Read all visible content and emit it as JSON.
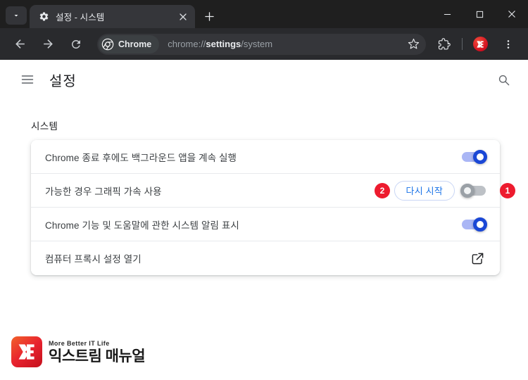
{
  "browser": {
    "window_title": "설정 - 시스템",
    "tab": {
      "title": "설정 - 시스템",
      "favicon": "gear-icon",
      "close_label": "×"
    },
    "tab_search_label": "chevron-down-icon",
    "new_tab_label": "+",
    "window_controls": {
      "minimize": "minimize-icon",
      "maximize": "maximize-icon",
      "close": "close-icon"
    },
    "toolbar": {
      "back": "back-arrow-icon",
      "forward": "forward-arrow-icon",
      "reload": "reload-icon",
      "site_chip_label": "Chrome",
      "url_prefix": "chrome://",
      "url_bold": "settings",
      "url_suffix": "/system",
      "url_full": "chrome://settings/system",
      "bookmark": "star-icon",
      "extensions": "puzzle-piece-icon",
      "profile": "profile-avatar",
      "menu": "three-dot-menu-icon"
    }
  },
  "settings": {
    "menu_label": "hamburger-menu-icon",
    "page_title": "설정",
    "search_label": "search-icon",
    "section_label": "시스템",
    "rows": [
      {
        "label": "Chrome 종료 후에도 백그라운드 앱을 계속 실행",
        "control": "toggle",
        "state": "on"
      },
      {
        "label": "가능한 경우 그래픽 가속 사용",
        "control": "toggle",
        "state": "off",
        "restart_button": "다시 시작"
      },
      {
        "label": "Chrome 기능 및 도움말에 관한 시스템 알림 표시",
        "control": "toggle",
        "state": "on"
      },
      {
        "label": "컴퓨터 프록시 설정 열기",
        "control": "external-link"
      }
    ]
  },
  "annotations": {
    "badge_1": "1",
    "badge_2": "2",
    "badge_color": "#ed1b2e"
  },
  "watermark": {
    "monogram": "EX",
    "tagline": "More Better IT Life",
    "name": "익스트림 매뉴얼"
  },
  "colors": {
    "tabstrip_bg": "#1f1f1f",
    "toolbar_bg": "#292a2d",
    "tab_active_bg": "#35363a",
    "toggle_on": "#1a47d6",
    "toggle_off": "#9aa0a6",
    "link_blue": "#1a73e8",
    "page_bg": "#ffffff"
  }
}
